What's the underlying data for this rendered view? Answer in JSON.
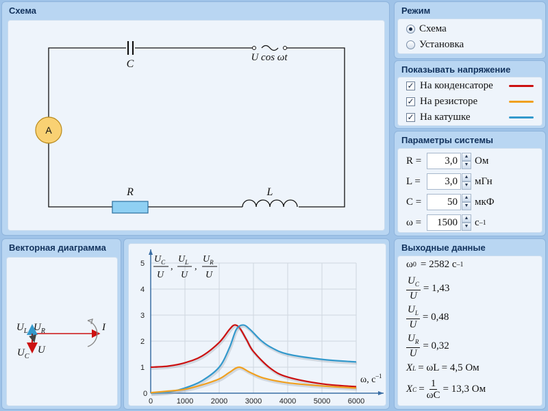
{
  "panels": {
    "scheme": {
      "title": "Схема"
    },
    "mode": {
      "title": "Режим",
      "options": [
        {
          "label": "Схема",
          "selected": true
        },
        {
          "label": "Установка",
          "selected": false
        }
      ]
    },
    "show_voltage": {
      "title": "Показывать напряжение",
      "items": [
        {
          "label": "На конденсаторе",
          "checked": true,
          "color": "#cc1111"
        },
        {
          "label": "На резисторе",
          "checked": true,
          "color": "#f0a020"
        },
        {
          "label": "На катушке",
          "checked": true,
          "color": "#3399cc"
        }
      ]
    },
    "params": {
      "title": "Параметры системы",
      "rows": [
        {
          "label": "R =",
          "value": "3,0",
          "unit": "Ом"
        },
        {
          "label": "L =",
          "value": "3,0",
          "unit": "мГн"
        },
        {
          "label": "C =",
          "value": "50",
          "unit": "мкФ"
        },
        {
          "label": "ω =",
          "value": "1500",
          "unit": "с"
        }
      ]
    },
    "vector": {
      "title": "Векторная диаграмма"
    },
    "output": {
      "title": "Выходные данные"
    }
  },
  "circuit": {
    "capacitor_label": "C",
    "source_label": "U cos ωt",
    "ammeter_label": "A",
    "resistor_label": "R",
    "inductor_label": "L"
  },
  "vector_diagram": {
    "labels": {
      "ul": "U",
      "ul_sub": "L",
      "ur": "U",
      "ur_sub": "R",
      "uc": "U",
      "uc_sub": "C",
      "u": "U",
      "i": "I"
    }
  },
  "output": {
    "omega0": {
      "label": "ω",
      "sub": "0",
      "eq": "= 2582 с",
      "exp": "–1"
    },
    "uc_ratio": {
      "num": "U",
      "num_sub": "C",
      "den": "U",
      "value": "= 1,43"
    },
    "ul_ratio": {
      "num": "U",
      "num_sub": "L",
      "den": "U",
      "value": "= 0,48"
    },
    "ur_ratio": {
      "num": "U",
      "num_sub": "R",
      "den": "U",
      "value": "= 0,32"
    },
    "xl": {
      "label": "X",
      "sub": "L",
      "eq": "= ωL = 4,5 Ом"
    },
    "xc": {
      "label": "X",
      "sub": "C",
      "num": "1",
      "den": "ωC",
      "eq": "= 13,3 Ом"
    }
  },
  "units": {
    "omega_exp": "–1"
  },
  "chart_data": {
    "type": "line",
    "xlabel": "ω, с–1",
    "ylabel": "UC/U, UL/U, UR/U",
    "xlim": [
      0,
      6000
    ],
    "ylim": [
      0,
      5
    ],
    "xticks": [
      "0",
      "1000",
      "2000",
      "3000",
      "4000",
      "5000",
      "6000"
    ],
    "yticks": [
      "1",
      "2",
      "3",
      "4",
      "5"
    ],
    "grid": true,
    "series": [
      {
        "name": "UC/U",
        "color": "#cc1111",
        "x": [
          0,
          500,
          1000,
          1500,
          2000,
          2300,
          2450,
          2600,
          2800,
          3000,
          3500,
          4000,
          5000,
          6000
        ],
        "y": [
          1.0,
          1.04,
          1.17,
          1.43,
          1.95,
          2.45,
          2.62,
          2.5,
          2.05,
          1.6,
          0.95,
          0.62,
          0.36,
          0.25
        ]
      },
      {
        "name": "UL/U",
        "color": "#3399cc",
        "x": [
          0,
          500,
          1000,
          1500,
          2000,
          2300,
          2500,
          2700,
          2900,
          3200,
          3500,
          4000,
          5000,
          6000
        ],
        "y": [
          0.0,
          0.04,
          0.2,
          0.48,
          1.0,
          1.75,
          2.45,
          2.62,
          2.45,
          2.05,
          1.77,
          1.5,
          1.3,
          1.2
        ]
      },
      {
        "name": "UR/U",
        "color": "#f0a020",
        "x": [
          0,
          500,
          1000,
          1500,
          2000,
          2300,
          2582,
          2900,
          3300,
          4000,
          5000,
          6000
        ],
        "y": [
          0.02,
          0.08,
          0.15,
          0.32,
          0.55,
          0.8,
          1.0,
          0.8,
          0.58,
          0.4,
          0.28,
          0.2
        ]
      }
    ]
  }
}
